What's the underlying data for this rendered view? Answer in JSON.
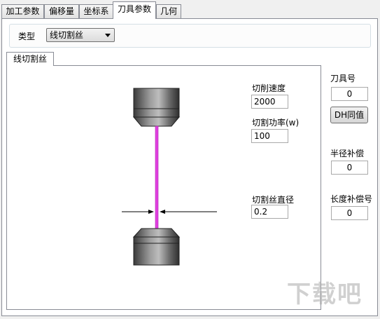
{
  "tabs": [
    "加工参数",
    "偏移量",
    "坐标系",
    "刀具参数",
    "几何"
  ],
  "active_tab": "刀具参数",
  "type_label": "类型",
  "type_value": "线切割丝",
  "inner_tab": "线切割丝",
  "fields": {
    "cut_speed": {
      "label": "切削速度",
      "value": "2000"
    },
    "cut_power": {
      "label": "切割功率(w)",
      "value": "100"
    },
    "wire_diameter": {
      "label": "切割丝直径",
      "value": "0.2"
    }
  },
  "right_panel": {
    "tool_number": {
      "label": "刀具号",
      "value": "0"
    },
    "dh_button": "DH同值",
    "radius_comp": {
      "label": "半径补偿",
      "value": "0"
    },
    "length_comp": {
      "label": "长度补偿号",
      "value": "0"
    }
  },
  "watermark": "下载吧",
  "colors": {
    "wire": "#e040e0",
    "tab_border": "#898c95",
    "panel_bg": "#ffffff"
  }
}
